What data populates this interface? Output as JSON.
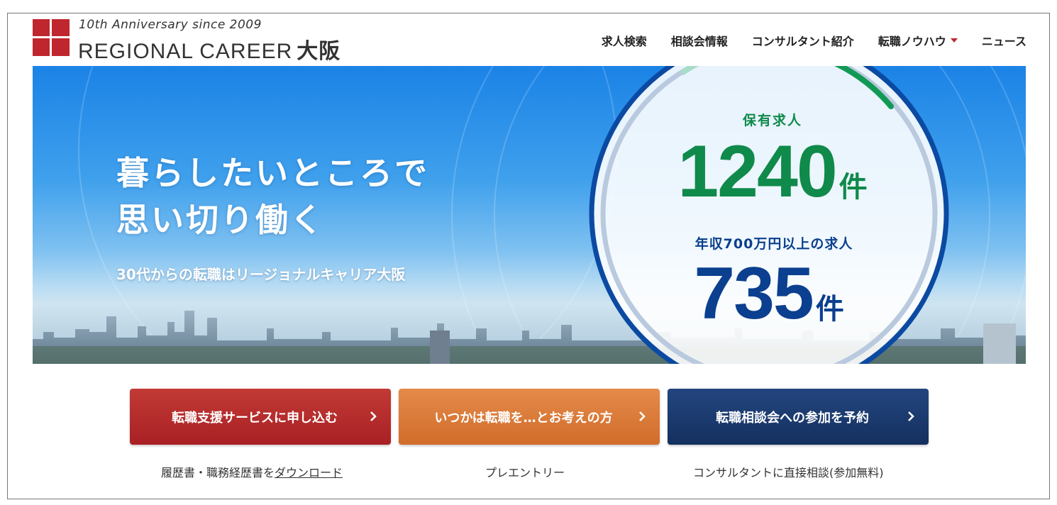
{
  "logo": {
    "tagline": "10th Anniversary since 2009",
    "name": "REGIONAL CAREER",
    "city": "大阪",
    "brand_color": "#c0262d"
  },
  "nav": {
    "items": [
      {
        "label": "求人検索"
      },
      {
        "label": "相談会情報"
      },
      {
        "label": "コンサルタント紹介"
      },
      {
        "label": "転職ノウハウ",
        "has_dropdown": true
      },
      {
        "label": "ニュース"
      }
    ]
  },
  "hero": {
    "headline_line1": "暮らしたいところで",
    "headline_line2": "思い切り働く",
    "subheadline": "30代からの転職はリージョナルキャリア大阪"
  },
  "stats": {
    "jobs_label": "保有求人",
    "jobs_count": "1240",
    "jobs_unit": "件",
    "high_income_label": "年収700万円以上の求人",
    "high_income_count": "735",
    "high_income_unit": "件",
    "green_color": "#0f8a4a",
    "navy_color": "#0b3f8f"
  },
  "cta": {
    "apply_label": "転職支援サービスに申し込む",
    "someday_label": "いつかは転職を…とお考えの方",
    "seminar_label": "転職相談会への参加を予約"
  },
  "sub_links": {
    "resume_prefix": "履歴書・職務経歴書を",
    "resume_link": "ダウンロード",
    "pre_entry": "プレエントリー",
    "consult": "コンサルタントに直接相談(参加無料)"
  }
}
